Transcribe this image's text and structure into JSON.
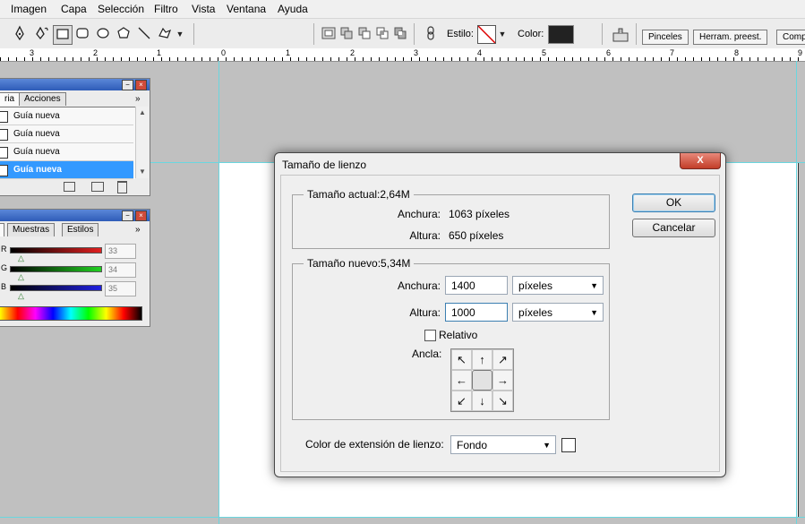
{
  "menubar": {
    "items": [
      "Imagen",
      "Capa",
      "Selección",
      "Filtro",
      "Vista",
      "Ventana",
      "Ayuda"
    ]
  },
  "toolbar": {
    "style_label": "Estilo:",
    "color_label": "Color:",
    "color_value": "#222222",
    "palette_tabs": [
      "Pinceles",
      "Herram. preest.",
      "Comp"
    ]
  },
  "ruler": {
    "numbers": [
      "3",
      "2",
      "1",
      "0",
      "1",
      "2",
      "3",
      "4",
      "5",
      "6",
      "7",
      "8",
      "9"
    ]
  },
  "history_palette": {
    "tabs": [
      "ria",
      "Acciones"
    ],
    "rows": [
      "Guía nueva",
      "Guía nueva",
      "Guía nueva",
      "Guía nueva"
    ],
    "selected_index": 3
  },
  "color_palette": {
    "tabs": [
      "Muestras",
      "Estilos"
    ],
    "sliders": [
      {
        "label": "R",
        "value": "33",
        "color": "#e02020"
      },
      {
        "label": "G",
        "value": "34",
        "color": "#20c020"
      },
      {
        "label": "B",
        "value": "35",
        "color": "#2020e0"
      }
    ]
  },
  "dialog": {
    "title": "Tamaño de lienzo",
    "close_label": "X",
    "current": {
      "title": "Tamaño actual:2,64M",
      "width_label": "Anchura:",
      "width_value": "1063 píxeles",
      "height_label": "Altura:",
      "height_value": "650 píxeles"
    },
    "new": {
      "title": "Tamaño nuevo:5,34M",
      "width_label": "Anchura:",
      "width_value": "1400",
      "width_unit": "píxeles",
      "height_label": "Altura:",
      "height_value": "1000",
      "height_unit": "píxeles",
      "relative_label": "Relativo",
      "anchor_label": "Ancla:"
    },
    "extension": {
      "label": "Color de extensión de lienzo:",
      "value": "Fondo"
    },
    "ok_label": "OK",
    "cancel_label": "Cancelar"
  }
}
